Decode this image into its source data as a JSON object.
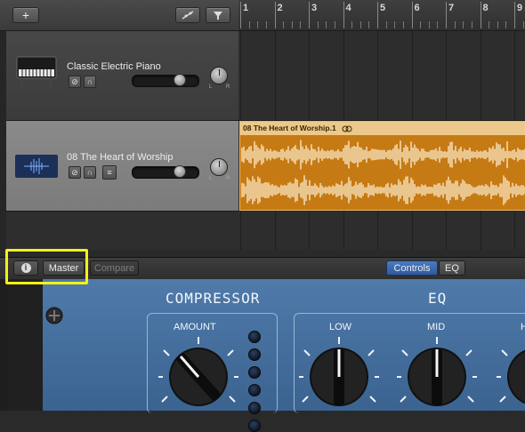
{
  "toolbar": {
    "add_icon": "plus-icon",
    "smart_icon": "smart-controls-icon",
    "filter_icon": "filter-icon"
  },
  "ruler": {
    "bars": [
      "1",
      "2",
      "3",
      "4",
      "5",
      "6",
      "7",
      "8",
      "9"
    ]
  },
  "tracks": [
    {
      "name": "Classic Electric Piano",
      "icon": "piano-icon",
      "volume_fraction": 0.78
    },
    {
      "name": "08 The Heart of Worship",
      "icon": "audio-waveform-icon",
      "volume_fraction": 0.78
    }
  ],
  "region": {
    "title": "08 The Heart of Worship.1",
    "loop_icon": "loop-icon"
  },
  "lower_toolbar": {
    "info_icon": "info-icon",
    "master_label": "Master",
    "compare_label": "Compare",
    "controls_label": "Controls",
    "eq_label": "EQ"
  },
  "plugin": {
    "compressor_title": "COMPRESSOR",
    "amount_label": "AMOUNT",
    "eq_title": "EQ",
    "low_label": "LOW",
    "mid_label": "MID",
    "high_label": "H"
  },
  "colors": {
    "highlight": "#f2f21a",
    "region": "#c67a14",
    "panel": "#4d78a7"
  }
}
